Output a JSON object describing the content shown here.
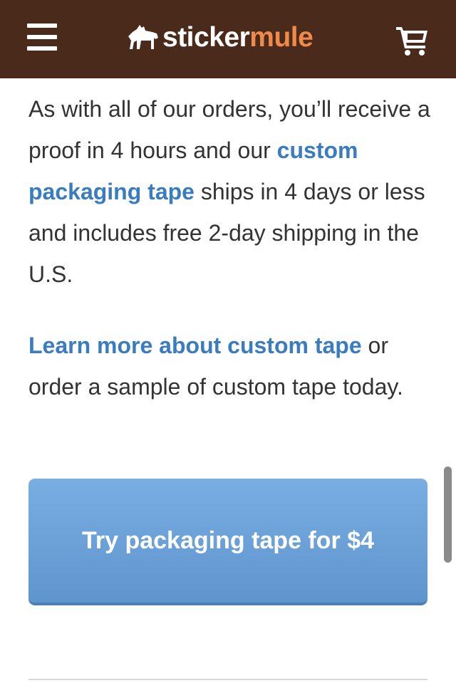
{
  "header": {
    "logo_part1": "sticker",
    "logo_part2": "mule",
    "menu_icon": "hamburger-menu-icon",
    "cart_icon": "shopping-cart-icon",
    "logo_icon": "mule-icon",
    "background_color": "#4a2a1b",
    "logo_accent_color": "#f08a4b"
  },
  "content": {
    "para1_text1": "As with all of our orders, you’ll receive a proof in 4 hours and our ",
    "para1_link": "custom packaging tape",
    "para1_text2": " ships in 4 days or less and includes free 2-day shipping in the U.S.",
    "para2_link": "Learn more about custom tape",
    "para2_text": " or order a sample of custom tape today.",
    "link_color": "#3a7cc0"
  },
  "cta": {
    "label": "Try packaging tape for $4",
    "color": "#6a9fd6"
  }
}
